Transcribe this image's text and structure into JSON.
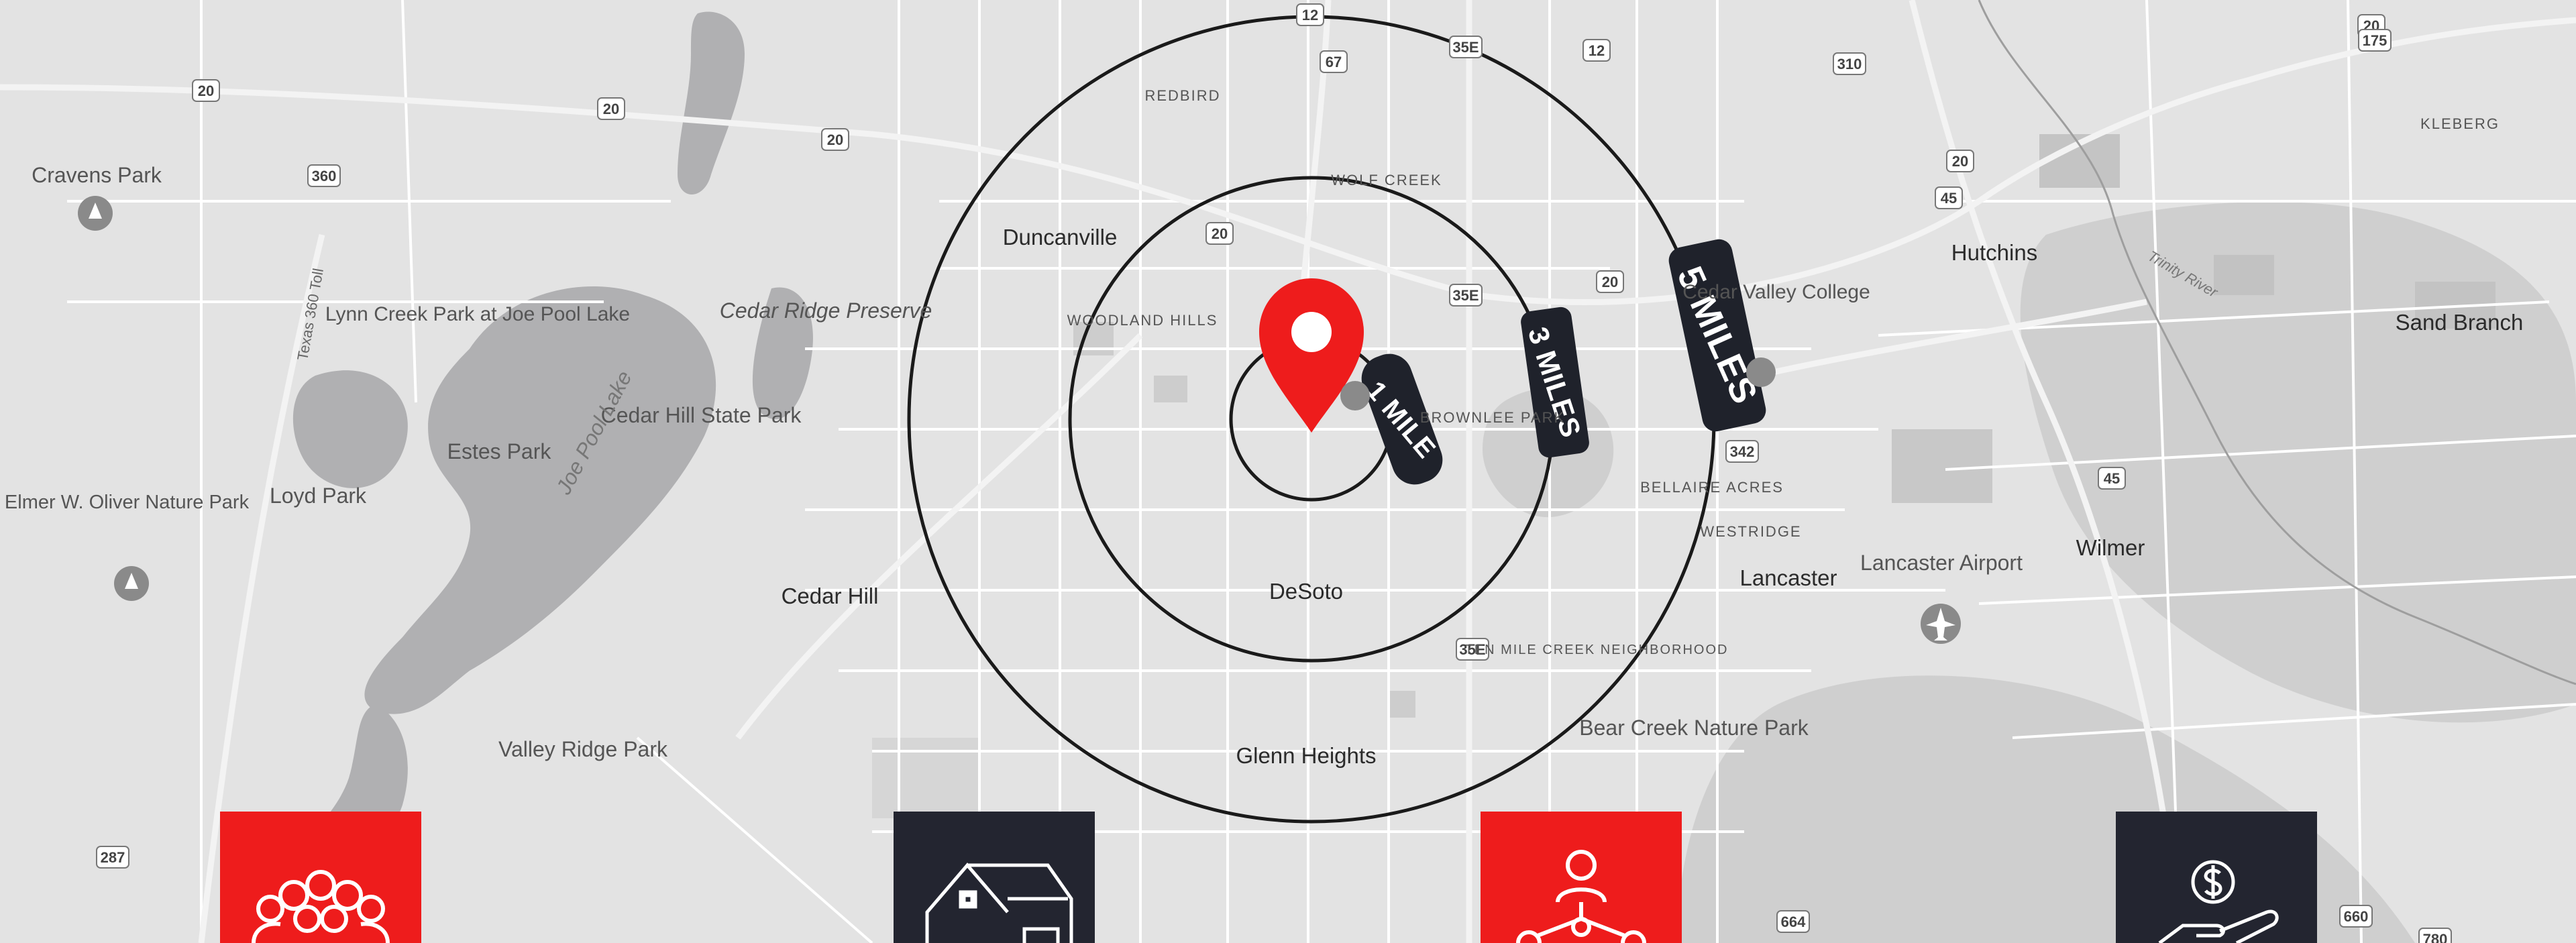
{
  "map": {
    "cities": [
      "Duncanville",
      "Cedar Hill",
      "DeSoto",
      "Glenn Heights",
      "Lancaster",
      "Hutchins",
      "Wilmer",
      "Sand Branch"
    ],
    "parks": [
      "Cravens Park",
      "Lynn Creek Park at Joe Pool Lake",
      "Cedar Ridge Preserve",
      "Cedar Hill State Park",
      "Joe Pool Lake",
      "Estes Park",
      "Loyd Park",
      "Elmer W. Oliver Nature Park",
      "Valley Ridge Park",
      "Bear Creek Nature Park",
      "Lancaster Airport",
      "Cedar Valley College"
    ],
    "neighborhoods": [
      "REDBIRD",
      "WOLF CREEK",
      "WOODLAND HILLS",
      "BROWNLEE PARK",
      "BELLAIRE ACRES",
      "WESTRIDGE",
      "TEN MILE CREEK NEIGHBORHOOD",
      "KLEBERG"
    ],
    "roads": [
      "Texas 360 Toll",
      "Trinity River",
      "20",
      "35E",
      "67",
      "12",
      "45",
      "342",
      "287",
      "310",
      "175",
      "664",
      "660",
      "780",
      "360"
    ]
  },
  "radius": {
    "ring1": "1 MILE",
    "ring3": "3 MILES",
    "ring5": "5 MILES",
    "badge_color": "#1f222b",
    "pin_color": "#ee1c1c"
  },
  "icons": [
    "population-icon",
    "households-icon",
    "network-icon",
    "income-icon"
  ],
  "colors": {
    "red": "#ee1c1c",
    "dark": "#232530"
  }
}
